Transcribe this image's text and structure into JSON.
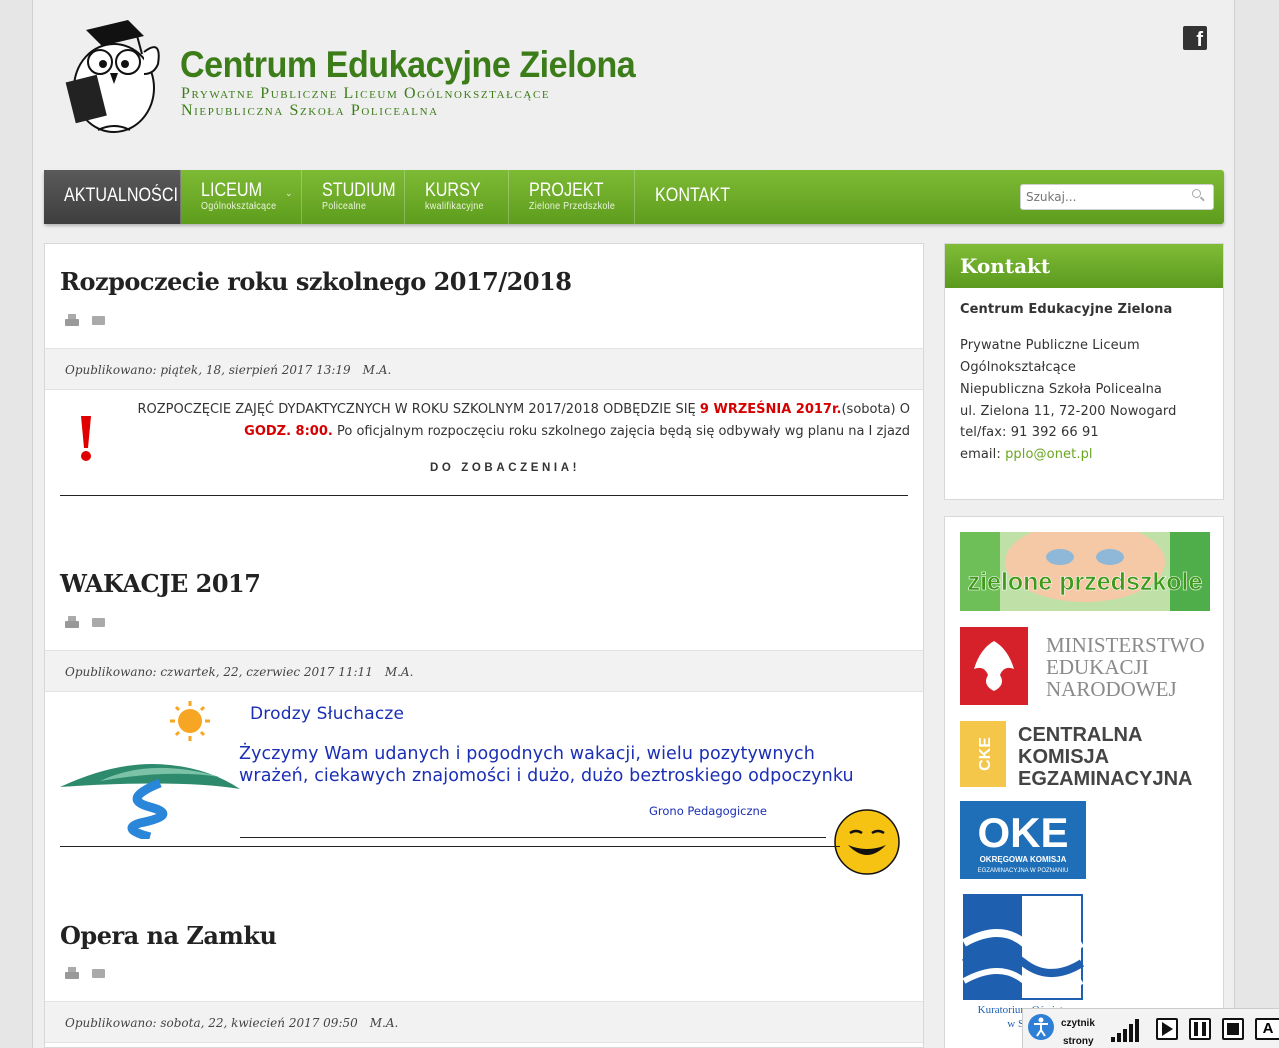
{
  "header": {
    "title": "Centrum Edukacyjne Zielona",
    "subtitle_line1": "Prywatne Publiczne Liceum Ogólnokształcące",
    "subtitle_line2": "Niepubliczna Szkoła Policealna",
    "social_icon": "facebook-icon"
  },
  "nav": {
    "items": [
      {
        "label": "AKTUALNOŚCI",
        "sub": ""
      },
      {
        "label": "LICEUM",
        "sub": "Ogólnokształcące"
      },
      {
        "label": "STUDIUM",
        "sub": "Policealne"
      },
      {
        "label": "KURSY",
        "sub": "kwalifikacyjne"
      },
      {
        "label": "PROJEKT",
        "sub": "Zielone Przedszkole"
      },
      {
        "label": "KONTAKT",
        "sub": ""
      }
    ],
    "search_placeholder": "Szukaj..."
  },
  "articles": [
    {
      "title": "Rozpoczecie roku szkolnego 2017/2018",
      "published": "Opublikowano: piątek, 18, sierpień 2017 13:19",
      "author": "M.A.",
      "text_a": "ROZPOCZĘCIE ZAJĘĆ DYDAKTYCZNYCH W ROKU SZKOLNYM 2017/2018 ODBĘDZIE SIĘ ",
      "text_red1": "9 WRZEŚNIA 2017r.",
      "text_b": "(sobota) O ",
      "text_red2": "GODZ. 8:00.",
      "text_c": " Po oficjalnym rozpoczęciu roku szkolnego zajęcia będą się odbywały wg planu na I zjazd",
      "closing": "DO ZOBACZENIA!"
    },
    {
      "title": "WAKACJE 2017",
      "published": "Opublikowano: czwartek, 22, czerwiec 2017 11:11",
      "author": "M.A.",
      "greeting": "Drodzy Słuchacze",
      "wish": "Życzymy Wam udanych i  pogodnych wakacji,  wielu pozytywnych wrażeń, ciekawych znajomości i dużo, dużo beztroskiego odpoczynku",
      "signature": "Grono Pedagogiczne"
    },
    {
      "title": "Opera na Zamku",
      "published": "Opublikowano: sobota, 22, kwiecień 2017 09:50",
      "author": "M.A."
    }
  ],
  "sidebar": {
    "contact_title": "Kontakt",
    "name": "Centrum Edukacyjne Zielona",
    "line1": "Prywatne Publiczne Liceum",
    "line2": "Ogólnokształcące",
    "line3": "Niepubliczna Szkoła Policealna",
    "address": "ul. Zielona 11, 72-200 Nowogard",
    "phone": "tel/fax: 91 392 66 91",
    "email_label": "email: ",
    "email": "pplo@onet.pl",
    "banners": {
      "przedszkole": "zielone przedszkole",
      "men_1": "MINISTERSTWO",
      "men_2": "EDUKACJI",
      "men_3": "NARODOWEJ",
      "cke_logo": "CKE",
      "cke_1": "CENTRALNA",
      "cke_2": "KOMISJA",
      "cke_3": "EGZAMINACYJNA",
      "oke_logo": "OKE",
      "oke_1": "OKRĘGOWA KOMISJA",
      "oke_2": "EGZAMINACYJNA W POZNANIU",
      "kuratorium": "Kuratorium Oświaty",
      "kuratorium_2": "w Szcz"
    }
  },
  "reader": {
    "label_1": "czytnik",
    "label_2": "strony",
    "font_button": "A"
  },
  "colors": {
    "brand_green": "#3c7d1a",
    "nav_green": "#6aa828",
    "accent_red": "#d60000",
    "wish_blue": "#1a2fb5"
  }
}
